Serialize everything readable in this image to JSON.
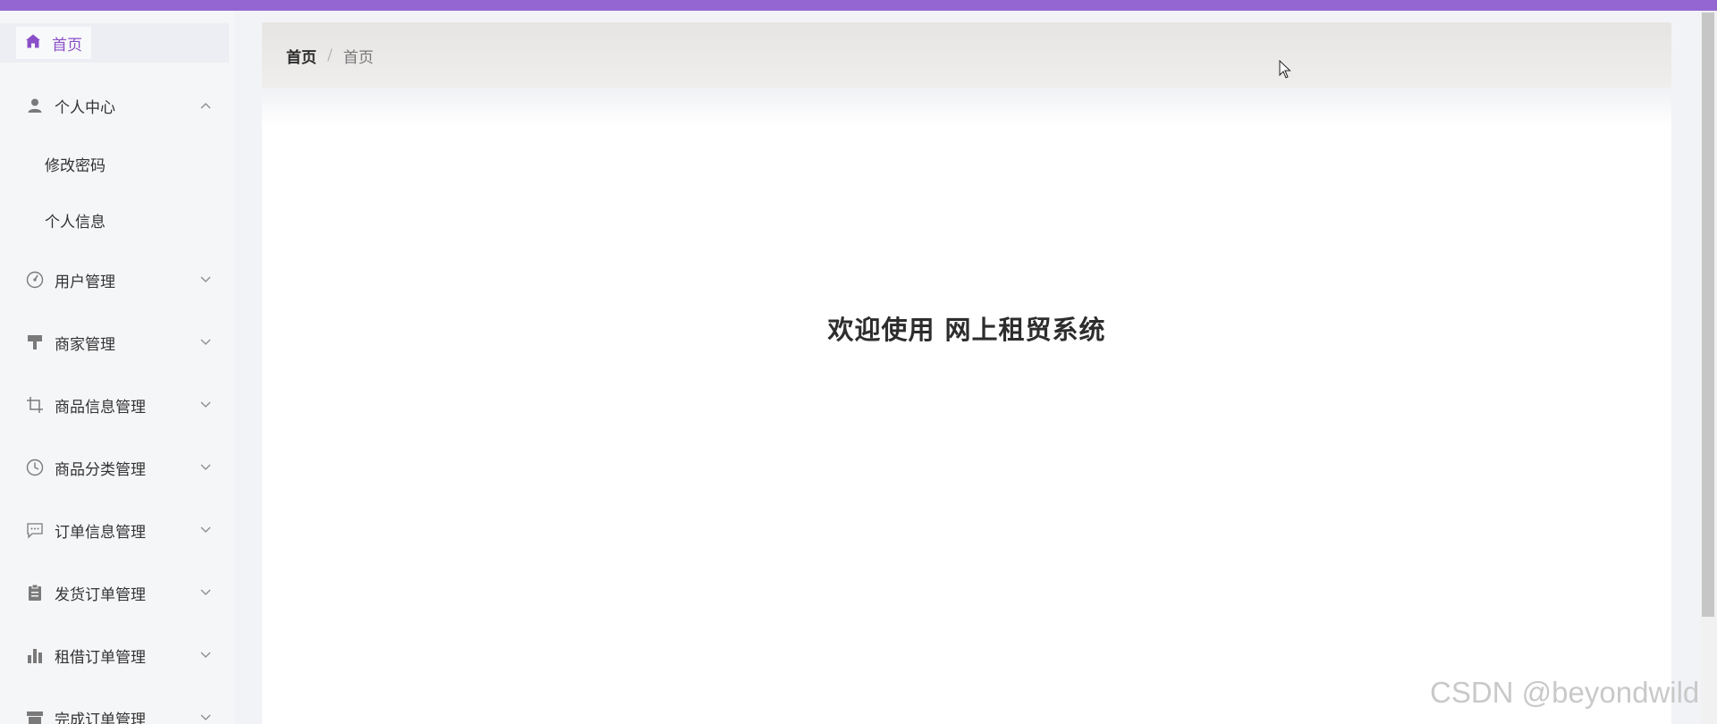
{
  "colors": {
    "topbar": "#9466d2",
    "accent": "#8a4fc8",
    "icon": "#7a7a7a"
  },
  "sidebar": {
    "home": {
      "label": "首页",
      "icon": "home-icon"
    },
    "personal_center": {
      "label": "个人中心",
      "icon": "user-icon",
      "expanded": true,
      "children": [
        {
          "label": "修改密码"
        },
        {
          "label": "个人信息"
        }
      ]
    },
    "items": [
      {
        "label": "用户管理",
        "icon": "dashboard-icon"
      },
      {
        "label": "商家管理",
        "icon": "brush-icon"
      },
      {
        "label": "商品信息管理",
        "icon": "crop-icon"
      },
      {
        "label": "商品分类管理",
        "icon": "clock-icon"
      },
      {
        "label": "订单信息管理",
        "icon": "chat-icon"
      },
      {
        "label": "发货订单管理",
        "icon": "clipboard-icon"
      },
      {
        "label": "租借订单管理",
        "icon": "bar-chart-icon"
      },
      {
        "label": "完成订单管理",
        "icon": "store-icon"
      }
    ]
  },
  "breadcrumb": {
    "current": "首页",
    "separator": "/",
    "last": "首页"
  },
  "main": {
    "welcome": "欢迎使用 网上租贸系统"
  },
  "watermark": "CSDN @beyondwild"
}
